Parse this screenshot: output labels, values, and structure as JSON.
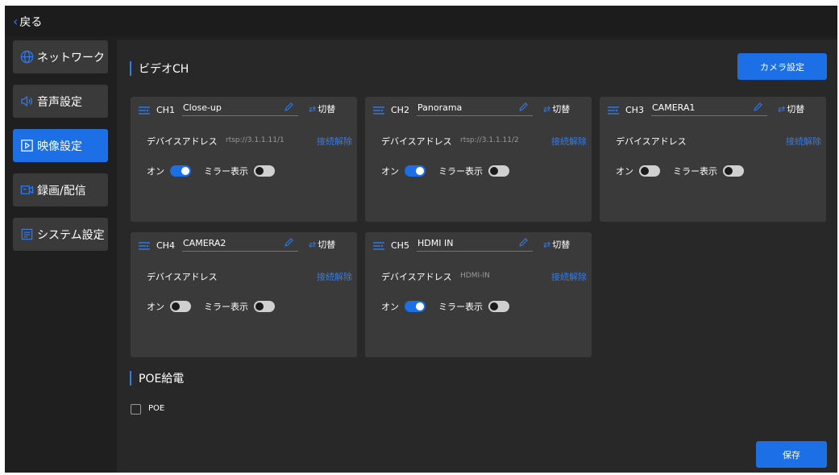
{
  "topbar": {
    "back_label": "戻る"
  },
  "sidebar": {
    "items": [
      {
        "label": "ネットワーク",
        "icon": "globe-icon",
        "active": false
      },
      {
        "label": "音声設定",
        "icon": "speaker-icon",
        "active": false
      },
      {
        "label": "映像設定",
        "icon": "play-icon",
        "active": true
      },
      {
        "label": "録画/配信",
        "icon": "camera-icon",
        "active": false
      },
      {
        "label": "システム設定",
        "icon": "document-icon",
        "active": false
      }
    ]
  },
  "main": {
    "video_section_title": "ビデオCH",
    "camera_settings_label": "カメラ設定",
    "address_label": "デバイスアドレス",
    "disconnect_label": "接続解除",
    "switch_label": "切替",
    "on_label": "オン",
    "mirror_label": "ミラー表示",
    "channels": [
      {
        "ch": "CH1",
        "name": "Close-up",
        "address": "rtsp://3.1.1.11/1",
        "on": true,
        "mirror": false
      },
      {
        "ch": "CH2",
        "name": "Panorama",
        "address": "rtsp://3.1.1.11/2",
        "on": true,
        "mirror": false
      },
      {
        "ch": "CH3",
        "name": "CAMERA1",
        "address": "",
        "on": false,
        "mirror": false
      },
      {
        "ch": "CH4",
        "name": "CAMERA2",
        "address": "",
        "on": false,
        "mirror": false
      },
      {
        "ch": "CH5",
        "name": "HDMI IN",
        "address": "HDMI-IN",
        "on": true,
        "mirror": false
      }
    ],
    "poe_section_title": "POE給電",
    "poe_label": "POE",
    "poe_checked": false,
    "save_label": "保存"
  },
  "colors": {
    "accent": "#1c6fe4",
    "link": "#2f7bf0",
    "background": "#1f1f1f",
    "panel": "#282828",
    "card": "#3a3a3a"
  }
}
